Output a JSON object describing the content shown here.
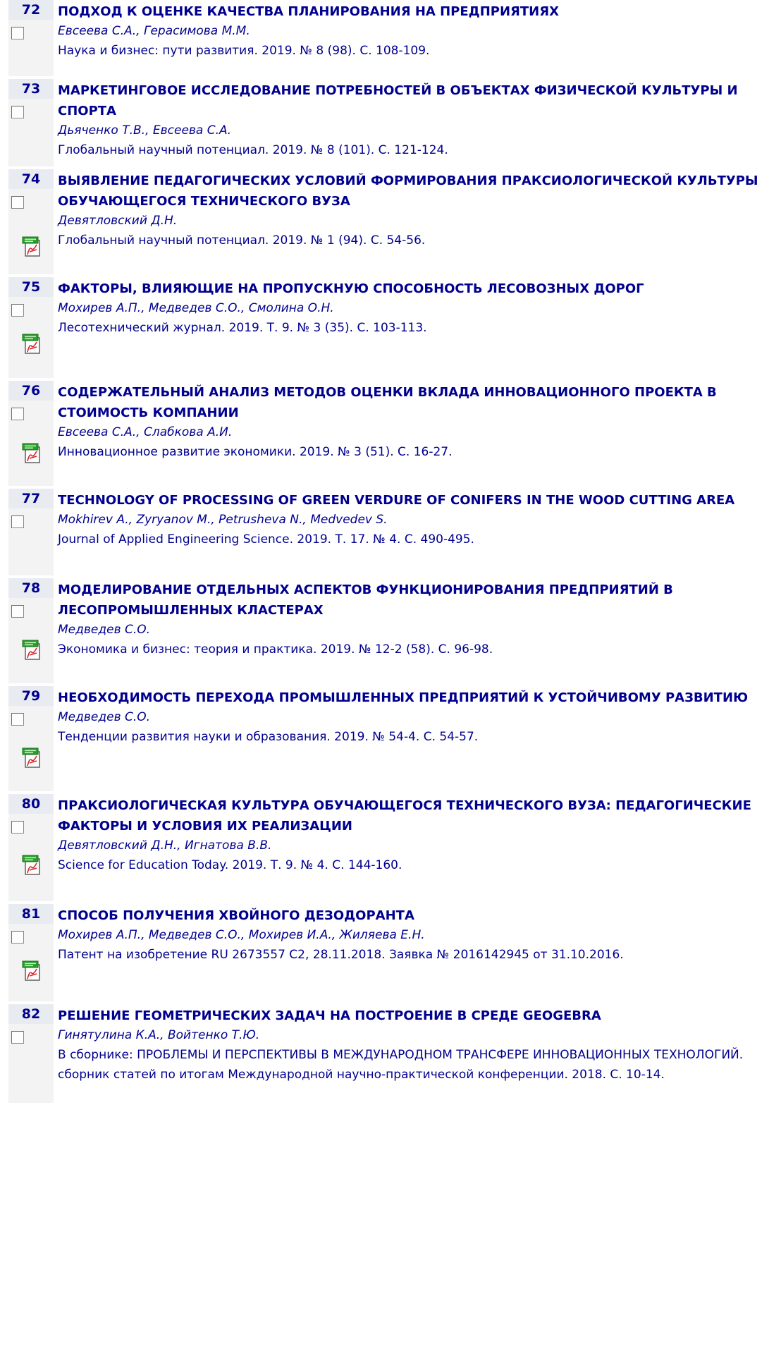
{
  "records": [
    {
      "num": "72",
      "title": "ПОДХОД К ОЦЕНКЕ КАЧЕСТВА ПЛАНИРОВАНИЯ НА ПРЕДПРИЯТИЯХ",
      "authors": "Евсеева С.А., Герасимова М.М.",
      "source": "Наука и бизнес: пути развития. 2019. № 8 (98). С. 108-109.",
      "has_pdf": false
    },
    {
      "num": "73",
      "title": "МАРКЕТИНГОВОЕ ИССЛЕДОВАНИЕ ПОТРЕБНОСТЕЙ В ОБЪЕКТАХ ФИЗИЧЕСКОЙ КУЛЬТУРЫ И СПОРТА",
      "authors": "Дьяченко Т.В., Евсеева С.А.",
      "source": "Глобальный научный потенциал. 2019. № 8 (101). С. 121-124.",
      "has_pdf": false
    },
    {
      "num": "74",
      "title": "ВЫЯВЛЕНИЕ ПЕДАГОГИЧЕСКИХ УСЛОВИЙ ФОРМИРОВАНИЯ ПРАКСИОЛОГИЧЕСКОЙ КУЛЬТУРЫ ОБУЧАЮЩЕГОСЯ ТЕХНИЧЕСКОГО ВУЗА",
      "authors": "Девятловский Д.Н.",
      "source": "Глобальный научный потенциал. 2019. № 1 (94). С. 54-56.",
      "has_pdf": true
    },
    {
      "num": "75",
      "title": "ФАКТОРЫ, ВЛИЯЮЩИЕ НА ПРОПУСКНУЮ СПОСОБНОСТЬ ЛЕСОВОЗНЫХ ДОРОГ",
      "authors": "Мохирев А.П., Медведев С.О., Смолина О.Н.",
      "source": "Лесотехнический журнал. 2019. Т. 9. № 3 (35). С. 103-113.",
      "has_pdf": true
    },
    {
      "num": "76",
      "title": "СОДЕРЖАТЕЛЬНЫЙ АНАЛИЗ МЕТОДОВ ОЦЕНКИ ВКЛАДА ИННОВАЦИОННОГО ПРОЕКТА В СТОИМОСТЬ КОМПАНИИ",
      "authors": "Евсеева С.А., Слабкова А.И.",
      "source": "Инновационное развитие экономики. 2019. № 3 (51). С. 16-27.",
      "has_pdf": true
    },
    {
      "num": "77",
      "title": "TECHNOLOGY OF PROCESSING OF GREEN VERDURE OF CONIFERS IN THE WOOD CUTTING AREA",
      "authors": "Mokhirev A., Zyryanov M., Petrusheva N., Medvedev S.",
      "source": "Journal of Applied Engineering Science. 2019. Т. 17. № 4. С. 490-495.",
      "has_pdf": false
    },
    {
      "num": "78",
      "title": "МОДЕЛИРОВАНИЕ ОТДЕЛЬНЫХ АСПЕКТОВ ФУНКЦИОНИРОВАНИЯ ПРЕДПРИЯТИЙ В ЛЕСОПРОМЫШЛЕННЫХ КЛАСТЕРАХ",
      "authors": "Медведев С.О.",
      "source": "Экономика и бизнес: теория и практика. 2019. № 12-2 (58). С. 96-98.",
      "has_pdf": true
    },
    {
      "num": "79",
      "title": "НЕОБХОДИМОСТЬ ПЕРЕХОДА ПРОМЫШЛЕННЫХ ПРЕДПРИЯТИЙ К УСТОЙЧИВОМУ РАЗВИТИЮ",
      "authors": "Медведев С.О.",
      "source": "Тенденции развития науки и образования. 2019. № 54-4. С. 54-57.",
      "has_pdf": true
    },
    {
      "num": "80",
      "title": "ПРАКСИОЛОГИЧЕСКАЯ КУЛЬТУРА ОБУЧАЮЩЕГОСЯ ТЕХНИЧЕСКОГО ВУЗА: ПЕДАГОГИЧЕСКИЕ ФАКТОРЫ И УСЛОВИЯ ИХ РЕАЛИЗАЦИИ",
      "authors": "Девятловский Д.Н., Игнатова В.В.",
      "source": "Science for Education Today. 2019. Т. 9. № 4. С. 144-160.",
      "has_pdf": true
    },
    {
      "num": "81",
      "title": "СПОСОБ ПОЛУЧЕНИЯ ХВОЙНОГО ДЕЗОДОРАНТА",
      "authors": "Мохирев А.П., Медведев С.О., Мохирев И.А., Жиляева Е.Н.",
      "source": "Патент на изобретение RU 2673557 C2, 28.11.2018. Заявка № 2016142945 от 31.10.2016.",
      "has_pdf": true
    },
    {
      "num": "82",
      "title": "РЕШЕНИЕ ГЕОМЕТРИЧЕСКИХ ЗАДАЧ НА ПОСТРОЕНИЕ В СРЕДЕ GEOGEBRA",
      "authors": "Гинятулина К.А., Войтенко Т.Ю.",
      "source": "В сборнике: ПРОБЛЕМЫ И ПЕРСПЕКТИВЫ В МЕЖДУНАРОДНОМ ТРАНСФЕРЕ ИННОВАЦИОННЫХ ТЕХНОЛОГИЙ. сборник статей по итогам Международной научно-практической конференции. 2018. С. 10-14.",
      "has_pdf": false
    }
  ],
  "colors": {
    "link": "#00008f",
    "number_bg": "#e8ebf0",
    "column_bg": "#f3f3f3",
    "pdf_green": "#2aa02a",
    "pdf_red": "#d2262a"
  },
  "icons": {
    "checkbox": "checkbox-icon",
    "pdf": "pdf-icon"
  }
}
